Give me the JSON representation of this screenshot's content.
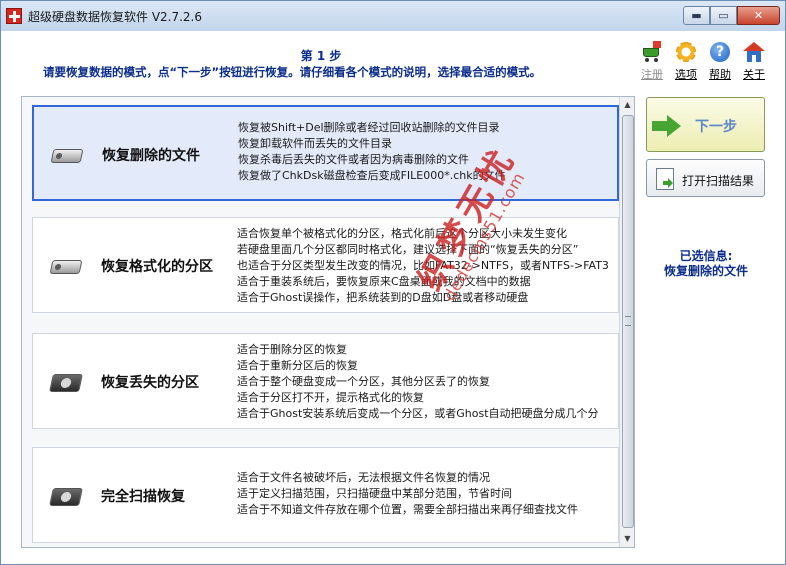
{
  "window": {
    "title": "超级硬盘数据恢复软件 V2.7.2.6",
    "buttons": {
      "minimize": "▬",
      "maximize": "▭",
      "close": "✕"
    }
  },
  "header": {
    "step": "第 1 步",
    "instruction": "请要恢复数据的模式，点“下一步”按钮进行恢复。请仔细看各个模式的说明，选择最合适的模式。"
  },
  "toolbar": {
    "items": [
      {
        "label": "注册",
        "icon": "cart-icon",
        "enabled": false
      },
      {
        "label": "选项",
        "icon": "gear-icon",
        "enabled": true
      },
      {
        "label": "帮助",
        "icon": "help-icon",
        "enabled": true
      },
      {
        "label": "关于",
        "icon": "home-icon",
        "enabled": true
      }
    ],
    "help_glyph": "?"
  },
  "modes": [
    {
      "name": "恢复删除的文件",
      "icon": "disk-icon",
      "selected": true,
      "lines": [
        "恢复被Shift+Del删除或者经过回收站删除的文件目录",
        "恢复卸载软件而丢失的文件目录",
        "恢复杀毒后丢失的文件或者因为病毒删除的文件",
        "恢复做了ChkDsk磁盘检查后变成FILE000*.chk的文件"
      ]
    },
    {
      "name": "恢复格式化的分区",
      "icon": "disk-icon",
      "selected": false,
      "lines": [
        "适合恢复单个被格式化的分区，格式化前后这个分区大小未发生变化",
        "若硬盘里面几个分区都同时格式化，建议选择下面的“恢复丢失的分区”",
        "也适合于分区类型发生改变的情况，比如FAT32->NTFS，或者NTFS->FAT3",
        "适合于重装系统后，要恢复原来C盘桌面或我的文档中的数据",
        "适合于Ghost误操作，把系统装到的D盘如D盘或者移动硬盘"
      ]
    },
    {
      "name": "恢复丢失的分区",
      "icon": "hard-disk-icon",
      "selected": false,
      "lines": [
        "适合于删除分区的恢复",
        "适合于重新分区后的恢复",
        "适合于整个硬盘变成一个分区，其他分区丢了的恢复",
        "适合于分区打不开，提示格式化的恢复",
        "适合于Ghost安装系统后变成一个分区，或者Ghost自动把硬盘分成几个分"
      ]
    },
    {
      "name": "完全扫描恢复",
      "icon": "hard-disk-icon",
      "selected": false,
      "lines": [
        "适合于文件名被破坏后，无法根据文件名恢复的情况",
        "适于定义扫描范围，只扫描硬盘中某部分范围，节省时间",
        "适合于不知道文件存放在哪个位置，需要全部扫描出来再仔细查找文件"
      ]
    }
  ],
  "scrollbar": {
    "up": "▲",
    "down": "▼"
  },
  "actions": {
    "next_label": "下一步",
    "open_scan_label": "打开扫描结果"
  },
  "selected_info": {
    "title": "已选信息:",
    "value": "恢复删除的文件"
  },
  "watermark": {
    "text": "织梦无忧",
    "url": "dedecms51.com"
  },
  "colors": {
    "heading": "#0b2d8c",
    "selection_border": "#3267d8",
    "selection_fill": "#e3ebfb",
    "next_fill": "#ecedb1",
    "watermark": "#cc2020"
  }
}
